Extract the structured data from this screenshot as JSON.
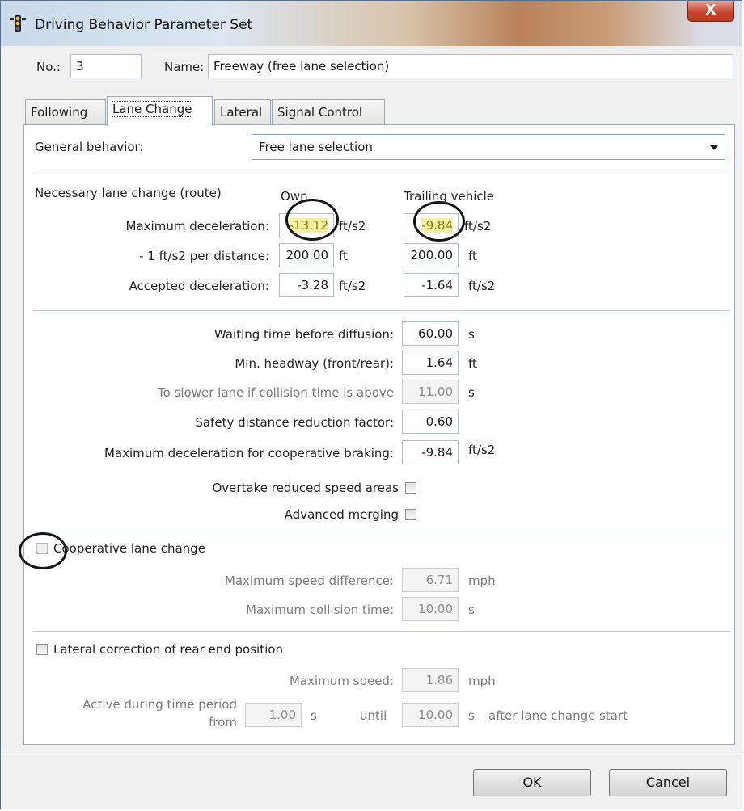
{
  "window": {
    "title": "Driving Behavior Parameter Set",
    "close_label": "X"
  },
  "header": {
    "no_label": "No.:",
    "no_value": "3",
    "name_label": "Name:",
    "name_value": "Freeway (free lane selection)"
  },
  "tabs": [
    {
      "label": "Following",
      "active": false
    },
    {
      "label": "Lane Change",
      "active": true
    },
    {
      "label": "Lateral",
      "active": false
    },
    {
      "label": "Signal Control",
      "active": false
    }
  ],
  "general": {
    "label": "General behavior:",
    "value": "Free lane selection"
  },
  "necessary": {
    "section_label": "Necessary lane change (route)",
    "col_own": "Own",
    "col_trailing": "Trailing vehicle",
    "rows": [
      {
        "label": "Maximum deceleration:",
        "own": "-13.12",
        "own_unit": "ft/s2",
        "trail": "-9.84",
        "trail_unit": "ft/s2"
      },
      {
        "label": "- 1 ft/s2 per distance:",
        "own": "200.00",
        "own_unit": "ft",
        "trail": "200.00",
        "trail_unit": "ft"
      },
      {
        "label": "Accepted deceleration:",
        "own": "-3.28",
        "own_unit": "ft/s2",
        "trail": "-1.64",
        "trail_unit": "ft/s2"
      }
    ]
  },
  "params": {
    "waiting": {
      "label": "Waiting time before diffusion:",
      "value": "60.00",
      "unit": "s"
    },
    "headway": {
      "label": "Min. headway (front/rear):",
      "value": "1.64",
      "unit": "ft"
    },
    "slower": {
      "label": "To slower lane if collision time is above",
      "value": "11.00",
      "unit": "s"
    },
    "safety": {
      "label": "Safety distance reduction factor:",
      "value": "0.60"
    },
    "coop_braking": {
      "label": "Maximum deceleration for cooperative braking:",
      "value": "-9.84",
      "unit": "ft/s2"
    },
    "overtake": {
      "label": "Overtake reduced speed areas",
      "checked": false
    },
    "merging": {
      "label": "Advanced merging",
      "checked": false
    }
  },
  "cooperative": {
    "label": "Cooperative lane change",
    "checked": false,
    "speed_diff": {
      "label": "Maximum speed difference:",
      "value": "6.71",
      "unit": "mph"
    },
    "collision": {
      "label": "Maximum collision time:",
      "value": "10.00",
      "unit": "s"
    }
  },
  "lateral": {
    "label": "Lateral correction of rear end position",
    "checked": false,
    "max_speed": {
      "label": "Maximum speed:",
      "value": "1.86",
      "unit": "mph"
    },
    "period_label_1": "Active during time period",
    "period_label_2": "from",
    "from_value": "1.00",
    "from_unit": "s",
    "until_label": "until",
    "until_value": "10.00",
    "until_unit": "s",
    "after_label": "after lane change start"
  },
  "buttons": {
    "ok": "OK",
    "cancel": "Cancel"
  },
  "colors": {
    "highlight": "#f3f0a0",
    "title_gradient_mid": "#b9825a"
  }
}
